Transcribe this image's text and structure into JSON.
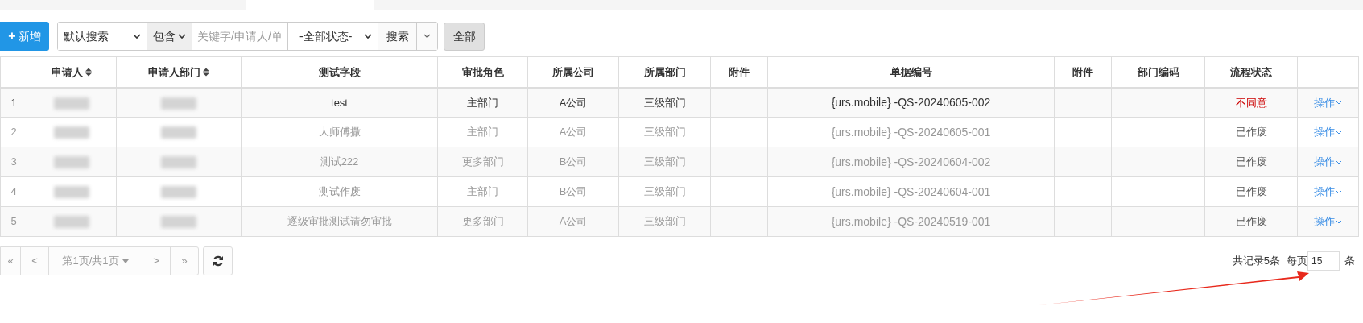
{
  "toolbar": {
    "add_button": {
      "icon": "+",
      "label": "新增"
    },
    "search_mode": "默认搜索",
    "match_mode": "包含",
    "keyword": {
      "placeholder": "关键字/申请人/单"
    },
    "status_filter": "-全部状态-",
    "search_button": "搜索",
    "all_button": "全部"
  },
  "table": {
    "columns": [
      {
        "sortable": false
      },
      {
        "label": "申请人",
        "sortable": true
      },
      {
        "label": "申请人部门",
        "sortable": true
      },
      {
        "label": "测试字段",
        "sortable": false
      },
      {
        "label": "审批角色",
        "sortable": false
      },
      {
        "label": "所属公司",
        "sortable": false
      },
      {
        "label": "所属部门",
        "sortable": false
      },
      {
        "label": "附件",
        "sortable": false
      },
      {
        "label": "单据编号",
        "sortable": false
      },
      {
        "label": "附件",
        "sortable": false
      },
      {
        "label": "部门编码",
        "sortable": false
      },
      {
        "label": "流程状态",
        "sortable": false
      },
      {
        "sortable": false
      }
    ],
    "rows": [
      {
        "index": "1",
        "voided": false,
        "field": "test",
        "role": "主部门",
        "company": "A公司",
        "dept": "三级部门",
        "number": "{urs.mobile} -QS-20240605-002",
        "status": "不同意",
        "color": "#cc0000",
        "action": "操作"
      },
      {
        "index": "2",
        "voided": true,
        "field": "大师傅撒",
        "role": "主部门",
        "company": "A公司",
        "dept": "三级部门",
        "number": "{urs.mobile} -QS-20240605-001",
        "status": "已作废",
        "color": "#555555",
        "action": "操作"
      },
      {
        "index": "3",
        "voided": true,
        "field": "测试222",
        "role": "更多部门",
        "company": "B公司",
        "dept": "三级部门",
        "number": "{urs.mobile} -QS-20240604-002",
        "status": "已作废",
        "color": "#555555",
        "action": "操作"
      },
      {
        "index": "4",
        "voided": true,
        "field": "测试作废",
        "role": "主部门",
        "company": "B公司",
        "dept": "三级部门",
        "number": "{urs.mobile} -QS-20240604-001",
        "status": "已作废",
        "color": "#555555",
        "action": "操作"
      },
      {
        "index": "5",
        "voided": true,
        "field": "逐级审批测试请勿审批",
        "role": "更多部门",
        "company": "A公司",
        "dept": "三级部门",
        "number": "{urs.mobile} -QS-20240519-001",
        "status": "已作废",
        "color": "#555555",
        "action": "操作"
      }
    ]
  },
  "pagination": {
    "first": "«",
    "prev": "<",
    "page": "第1页/共1页",
    "next": ">",
    "last": "»",
    "total": "共记录5条",
    "per_page_label": "每页",
    "per_page": "15",
    "unit": "条"
  }
}
